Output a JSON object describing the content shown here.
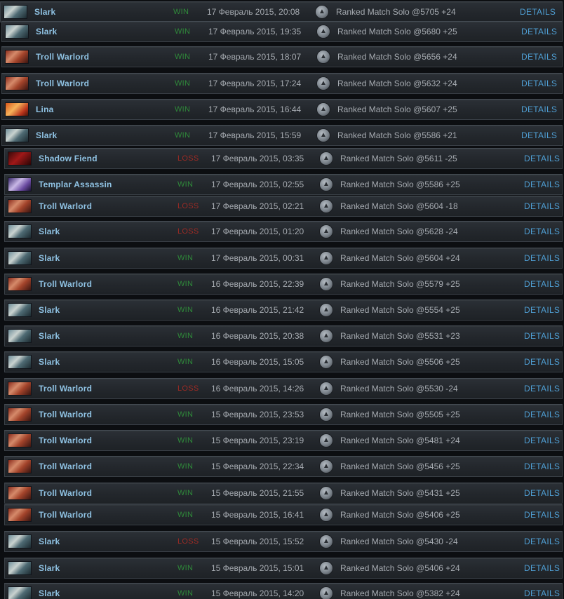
{
  "details_label": "DETAILS",
  "mode_icon": "ranked-emblem-icon",
  "colors": {
    "win": "#2f8a3a",
    "loss": "#9b2b25",
    "hero_name": "#8fc2e3",
    "details_link": "#4f9fd4"
  },
  "matches": [
    {
      "hero": "Slark",
      "hero_icon": "slark-portrait",
      "result": "WIN",
      "date": "17 Февраль 2015, 20:08",
      "mode": "Ranked Match Solo @5705 +24"
    },
    {
      "hero": "Slark",
      "hero_icon": "slark-portrait",
      "result": "WIN",
      "date": "17 Февраль 2015, 19:35",
      "mode": "Ranked Match Solo @5680 +25"
    },
    {
      "hero": "Troll Warlord",
      "hero_icon": "troll-warlord-portrait",
      "result": "WIN",
      "date": "17 Февраль 2015, 18:07",
      "mode": "Ranked Match Solo @5656 +24"
    },
    {
      "hero": "Troll Warlord",
      "hero_icon": "troll-warlord-portrait",
      "result": "WIN",
      "date": "17 Февраль 2015, 17:24",
      "mode": "Ranked Match Solo @5632 +24"
    },
    {
      "hero": "Lina",
      "hero_icon": "lina-portrait",
      "result": "WIN",
      "date": "17 Февраль 2015, 16:44",
      "mode": "Ranked Match Solo @5607 +25"
    },
    {
      "hero": "Slark",
      "hero_icon": "slark-portrait",
      "result": "WIN",
      "date": "17 Февраль 2015, 15:59",
      "mode": "Ranked Match Solo @5586 +21"
    },
    {
      "hero": "Shadow Fiend",
      "hero_icon": "shadow-fiend-portrait",
      "result": "LOSS",
      "date": "17 Февраль 2015, 03:35",
      "mode": "Ranked Match Solo @5611 -25"
    },
    {
      "hero": "Templar Assassin",
      "hero_icon": "templar-assassin-portrait",
      "result": "WIN",
      "date": "17 Февраль 2015, 02:55",
      "mode": "Ranked Match Solo @5586 +25"
    },
    {
      "hero": "Troll Warlord",
      "hero_icon": "troll-warlord-portrait",
      "result": "LOSS",
      "date": "17 Февраль 2015, 02:21",
      "mode": "Ranked Match Solo @5604 -18"
    },
    {
      "hero": "Slark",
      "hero_icon": "slark-portrait",
      "result": "LOSS",
      "date": "17 Февраль 2015, 01:20",
      "mode": "Ranked Match Solo @5628 -24"
    },
    {
      "hero": "Slark",
      "hero_icon": "slark-portrait",
      "result": "WIN",
      "date": "17 Февраль 2015, 00:31",
      "mode": "Ranked Match Solo @5604 +24"
    },
    {
      "hero": "Troll Warlord",
      "hero_icon": "troll-warlord-portrait",
      "result": "WIN",
      "date": "16 Февраль 2015, 22:39",
      "mode": "Ranked Match Solo @5579 +25"
    },
    {
      "hero": "Slark",
      "hero_icon": "slark-portrait",
      "result": "WIN",
      "date": "16 Февраль 2015, 21:42",
      "mode": "Ranked Match Solo @5554 +25"
    },
    {
      "hero": "Slark",
      "hero_icon": "slark-portrait",
      "result": "WIN",
      "date": "16 Февраль 2015, 20:38",
      "mode": "Ranked Match Solo @5531 +23"
    },
    {
      "hero": "Slark",
      "hero_icon": "slark-portrait",
      "result": "WIN",
      "date": "16 Февраль 2015, 15:05",
      "mode": "Ranked Match Solo @5506 +25"
    },
    {
      "hero": "Troll Warlord",
      "hero_icon": "troll-warlord-portrait",
      "result": "LOSS",
      "date": "16 Февраль 2015, 14:26",
      "mode": "Ranked Match Solo @5530 -24"
    },
    {
      "hero": "Troll Warlord",
      "hero_icon": "troll-warlord-portrait",
      "result": "WIN",
      "date": "15 Февраль 2015, 23:53",
      "mode": "Ranked Match Solo @5505 +25"
    },
    {
      "hero": "Troll Warlord",
      "hero_icon": "troll-warlord-portrait",
      "result": "WIN",
      "date": "15 Февраль 2015, 23:19",
      "mode": "Ranked Match Solo @5481 +24"
    },
    {
      "hero": "Troll Warlord",
      "hero_icon": "troll-warlord-portrait",
      "result": "WIN",
      "date": "15 Февраль 2015, 22:34",
      "mode": "Ranked Match Solo @5456 +25"
    },
    {
      "hero": "Troll Warlord",
      "hero_icon": "troll-warlord-portrait",
      "result": "WIN",
      "date": "15 Февраль 2015, 21:55",
      "mode": "Ranked Match Solo @5431 +25"
    },
    {
      "hero": "Troll Warlord",
      "hero_icon": "troll-warlord-portrait",
      "result": "WIN",
      "date": "15 Февраль 2015, 16:41",
      "mode": "Ranked Match Solo @5406 +25"
    },
    {
      "hero": "Slark",
      "hero_icon": "slark-portrait",
      "result": "LOSS",
      "date": "15 Февраль 2015, 15:52",
      "mode": "Ranked Match Solo @5430 -24"
    },
    {
      "hero": "Slark",
      "hero_icon": "slark-portrait",
      "result": "WIN",
      "date": "15 Февраль 2015, 15:01",
      "mode": "Ranked Match Solo @5406 +24"
    },
    {
      "hero": "Slark",
      "hero_icon": "slark-portrait",
      "result": "WIN",
      "date": "15 Февраль 2015, 14:20",
      "mode": "Ranked Match Solo @5382 +24"
    }
  ]
}
